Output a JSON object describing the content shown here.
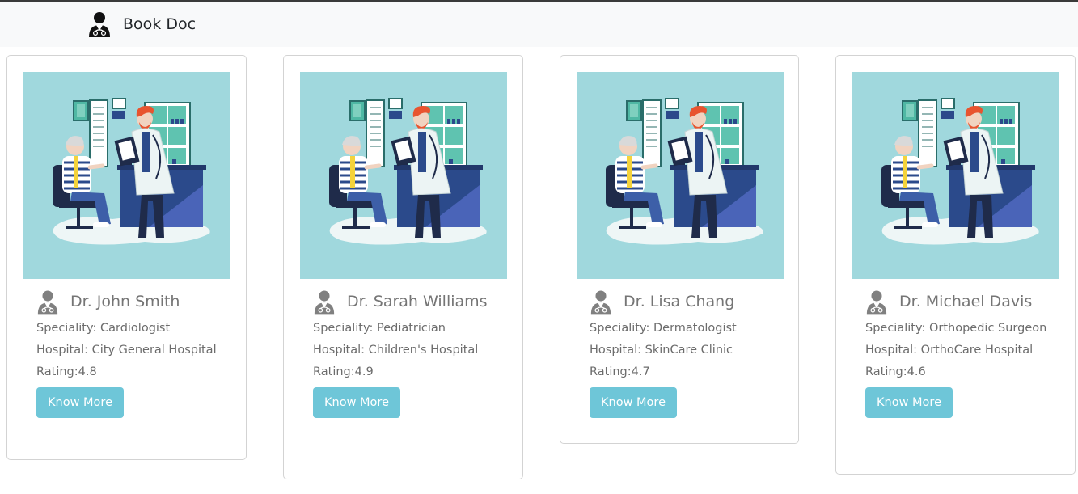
{
  "navbar": {
    "brand_icon": "doctor-icon",
    "brand_text": "Book Doc"
  },
  "doctors": [
    {
      "name": "Dr. John Smith",
      "speciality": "Speciality: Cardiologist",
      "hospital": "Hospital: City General Hospital",
      "rating": "Rating:4.8",
      "button": "Know More"
    },
    {
      "name": "Dr. Sarah Williams",
      "speciality": "Speciality: Pediatrician",
      "hospital": "Hospital: Children's Hospital",
      "rating": "Rating:4.9",
      "button": "Know More"
    },
    {
      "name": "Dr. Lisa Chang",
      "speciality": "Speciality: Dermatologist",
      "hospital": "Hospital: SkinCare Clinic",
      "rating": "Rating:4.7",
      "button": "Know More"
    },
    {
      "name": "Dr. Michael Davis",
      "speciality": "Speciality: Orthopedic Surgeon",
      "hospital": "Hospital: OrthoCare Hospital",
      "rating": "Rating:4.6",
      "button": "Know More"
    }
  ],
  "theme": {
    "navbar_bg": "#f8f9fa",
    "button_bg": "#6ec6d8",
    "illustration_bg": "#a0d8dd",
    "card_border": "#d3d3d3"
  }
}
